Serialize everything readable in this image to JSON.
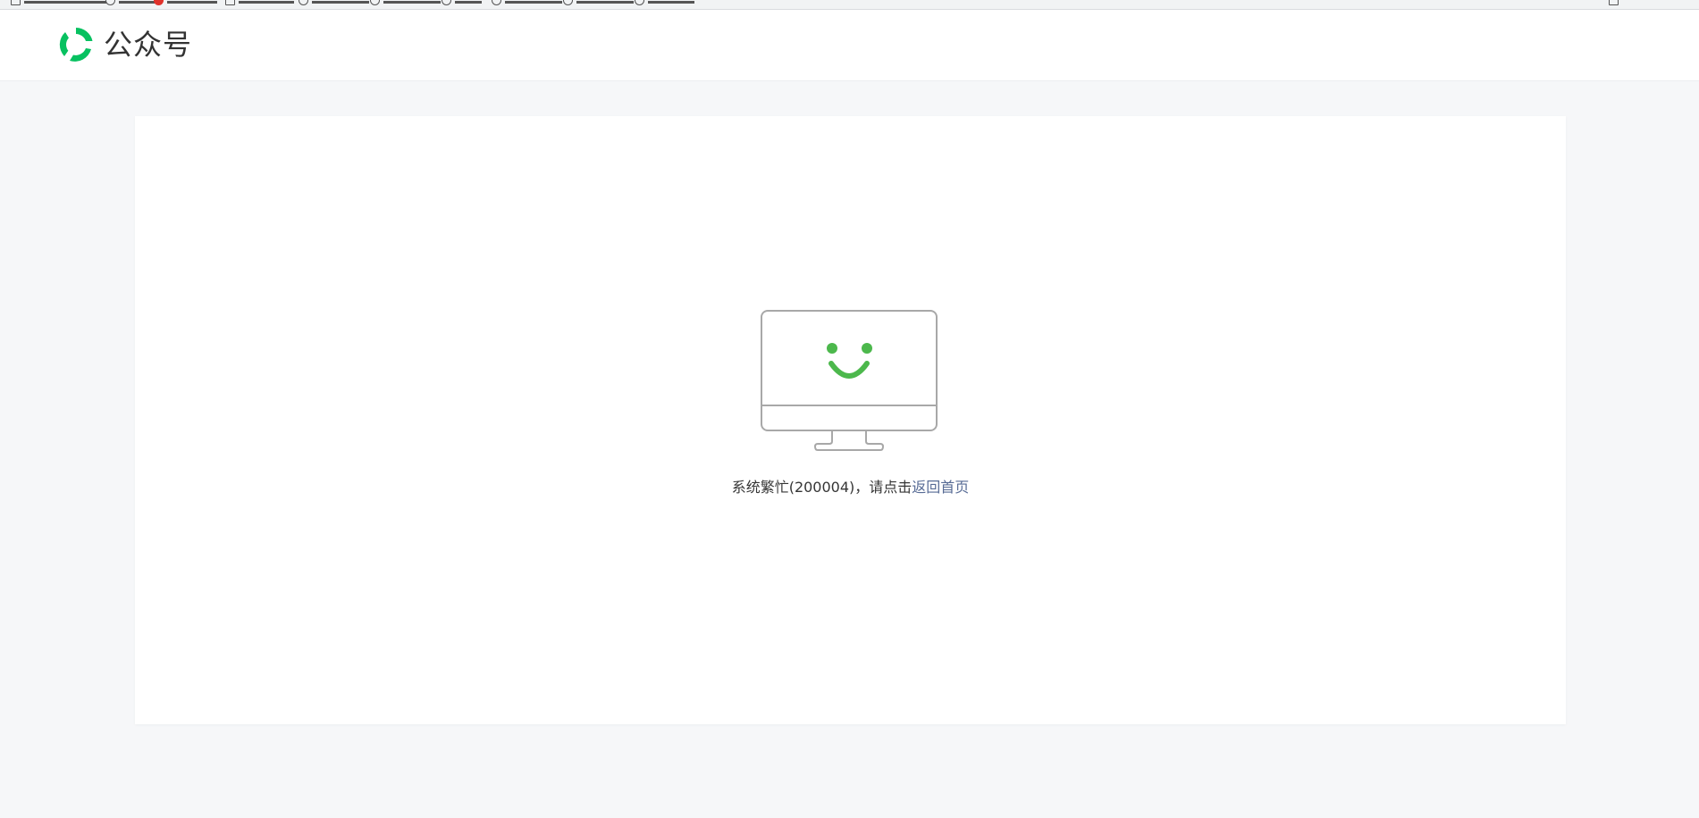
{
  "header": {
    "brand_name": "公众号",
    "brand_color": "#07c160"
  },
  "main": {
    "error_message_prefix": "系统繁忙(200004)，请点击",
    "back_home_link": "返回首页",
    "link_color": "#576b95",
    "smile_color": "#4cb84c"
  }
}
